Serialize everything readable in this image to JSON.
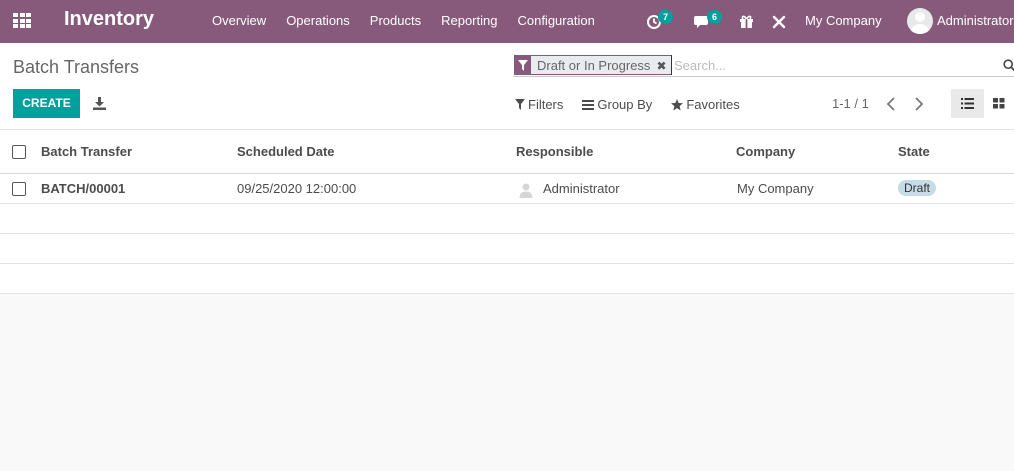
{
  "topbar": {
    "app_name": "Inventory",
    "menu": [
      "Overview",
      "Operations",
      "Products",
      "Reporting",
      "Configuration"
    ],
    "activity_count": "7",
    "messages_count": "6",
    "company": "My Company",
    "user": "Administrator"
  },
  "control": {
    "breadcrumb": "Batch Transfers",
    "facet_value": "Draft or In Progress",
    "search_placeholder": "Search...",
    "create_label": "CREATE",
    "filters_label": "Filters",
    "group_by_label": "Group By",
    "favorites_label": "Favorites",
    "pager_value": "1-1 / 1"
  },
  "table": {
    "columns": [
      "Batch Transfer",
      "Scheduled Date",
      "Responsible",
      "Company",
      "State"
    ],
    "rows": [
      {
        "batch": "BATCH/00001",
        "scheduled_date": "09/25/2020 12:00:00",
        "responsible": "Administrator",
        "company": "My Company",
        "state": "Draft"
      }
    ]
  },
  "colors": {
    "brand": "#875a7b",
    "accent": "#00a09d",
    "state_draft_bg": "#c5dbe6"
  }
}
